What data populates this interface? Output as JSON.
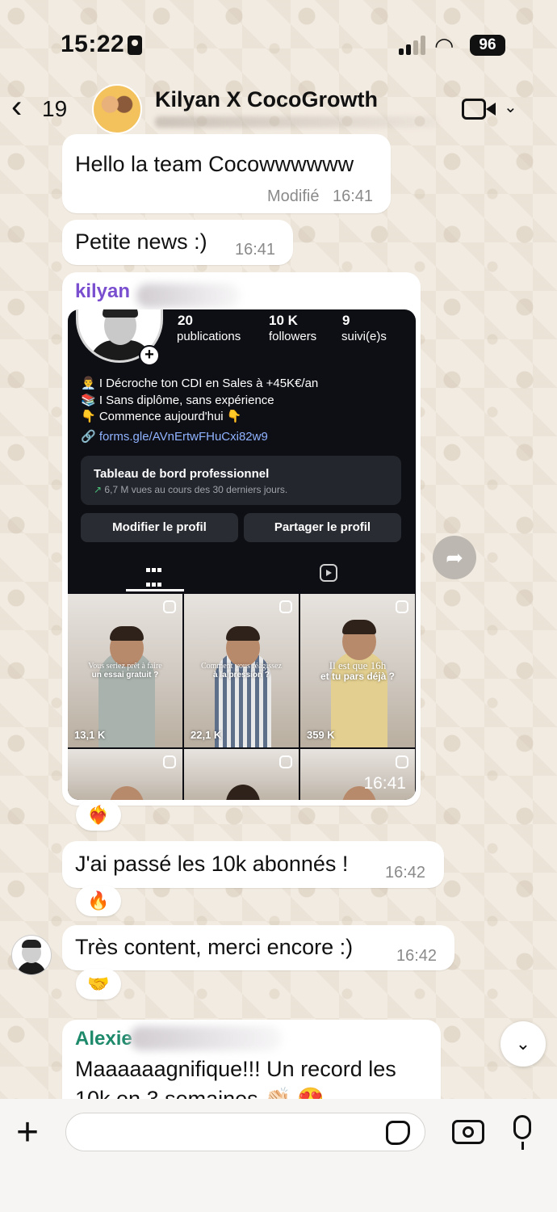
{
  "status_bar": {
    "time": "15:22",
    "battery": "96"
  },
  "header": {
    "back_count": "19",
    "title": "Kilyan X CocoGrowth",
    "avatar_label": "CocoGrowth"
  },
  "messages": {
    "m1": {
      "sender_partial": "kilyan Le Lard",
      "text": "Hello la team Cocowwwwww",
      "edited": "Modifié",
      "time": "16:41"
    },
    "m2": {
      "text": "Petite news :)",
      "time": "16:41"
    },
    "m3": {
      "sender": "kilyan",
      "time": "16:41",
      "reaction": "❤️‍🔥"
    },
    "m4": {
      "text": "J'ai passé les 10k abonnés !",
      "time": "16:42",
      "reaction": "🔥"
    },
    "m5": {
      "text": "Très content, merci encore :)",
      "time": "16:42",
      "reaction": "🤝"
    },
    "m6": {
      "sender": "Alexie",
      "text_line1": "Maaaaaagnifique!!! Un record les",
      "text_line2": "10k en 3 semaines 👏🏻 😍"
    }
  },
  "instagram": {
    "stats": [
      {
        "value": "20",
        "label": "publications"
      },
      {
        "value": "10 K",
        "label": "followers"
      },
      {
        "value": "9",
        "label": "suivi(e)s"
      }
    ],
    "bio": [
      "👨‍💼 I Décroche ton CDI en Sales à +45K€/an",
      "📚 I Sans diplôme, sans expérience",
      "👇 Commence aujourd'hui 👇"
    ],
    "link": "forms.gle/AVnErtwFHuCxi82w9",
    "dashboard": {
      "title": "Tableau de bord professionnel",
      "subtitle": "6,7 M vues au cours des 30 derniers jours."
    },
    "buttons": {
      "edit": "Modifier le profil",
      "share": "Partager le profil"
    },
    "tiles": [
      {
        "caption": "Vous seriez prêt à faire",
        "caption_bold": "un essai gratuit ?",
        "views": "13,1 K"
      },
      {
        "caption": "Comment vous réagissez",
        "caption_bold": "à la pression ?",
        "views": "22,1 K"
      },
      {
        "caption": "Il est que 16h",
        "caption_bold": "et tu pars déjà ?",
        "views": "359 K"
      }
    ]
  },
  "composer": {
    "placeholder": ""
  }
}
